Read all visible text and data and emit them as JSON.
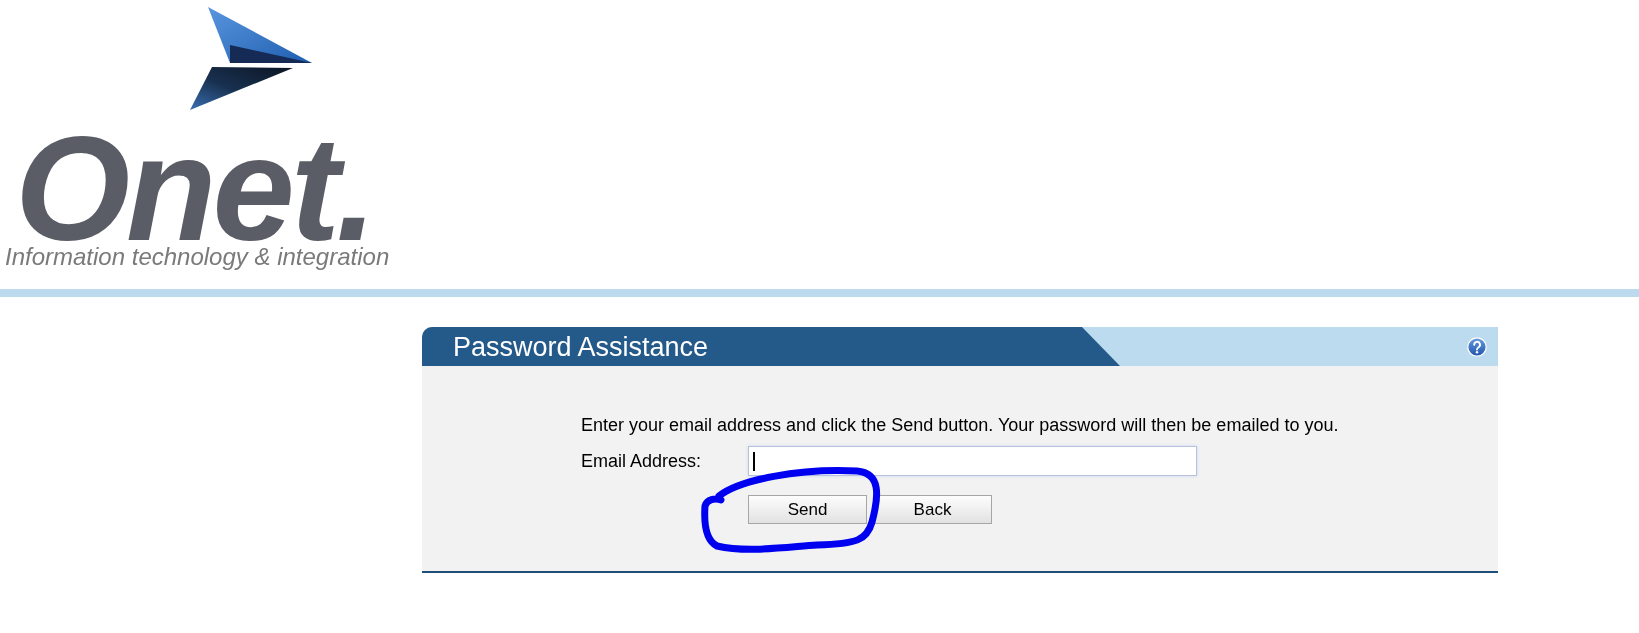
{
  "logo": {
    "name": "Onet.",
    "tagline": "Information technology & integration"
  },
  "panel": {
    "title": "Password Assistance",
    "instructions": "Enter your email address and click the Send button. Your password will then be emailed to you.",
    "email_field": {
      "label": "Email Address:",
      "focused": true
    },
    "buttons": [
      {
        "label": "Send"
      },
      {
        "label": "Back"
      }
    ]
  }
}
